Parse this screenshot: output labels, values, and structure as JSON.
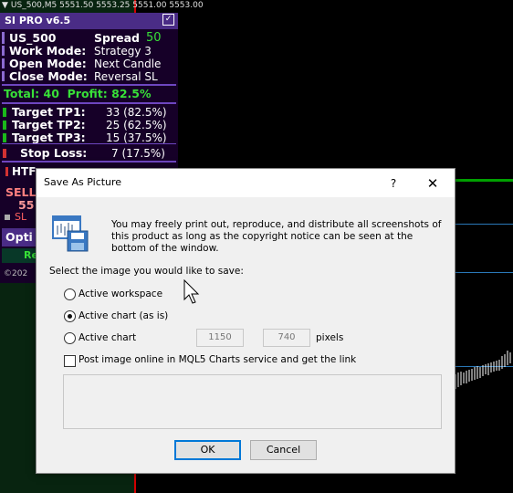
{
  "chart": {
    "title": "US_500,M5  5551.50 5553.25 5551.00 5553.00"
  },
  "panel": {
    "header": "SI PRO v6.5",
    "symbol": "US_500",
    "spread_label": "Spread",
    "spread_value": "50",
    "work_mode_label": "Work Mode:",
    "work_mode_value": "Strategy 3",
    "open_mode_label": "Open Mode:",
    "open_mode_value": "Next Candle",
    "close_mode_label": "Close Mode:",
    "close_mode_value": "Reversal SL",
    "total": "Total: 40",
    "profit": "Profit: 82.5%",
    "tp1_label": "Target TP1:",
    "tp1_value": "33 (82.5%)",
    "tp2_label": "Target TP2:",
    "tp2_value": "25 (62.5%)",
    "tp3_label": "Target TP3:",
    "tp3_value": "15 (37.5%)",
    "sl_label": "Stop Loss:",
    "sl_value": "7 (17.5%)",
    "partial": {
      "htf": "HTF",
      "sell": "SELL",
      "sell_num": "55",
      "sl": "SL",
      "opti": "Opti",
      "re": "Re",
      "copyright": "©202"
    }
  },
  "dialog": {
    "title": "Save As Picture",
    "help": "?",
    "close": "✕",
    "intro": "You may freely print out, reproduce, and distribute all screenshots of this product as long as the copyright notice can be seen at the bottom of the window.",
    "select_label": "Select the image you would like to save:",
    "options": {
      "active_workspace": "Active workspace",
      "active_chart_as_is": "Active chart (as is)",
      "active_chart": "Active chart"
    },
    "width_value": "1150",
    "height_value": "740",
    "x_label": "x",
    "pixels_label": "pixels",
    "post_online_label": "Post image online in MQL5 Charts service and get the link",
    "ok": "OK",
    "cancel": "Cancel"
  },
  "colors": {
    "panel_bg": "#160028",
    "panel_header": "#4a2c86",
    "profit_green": "#38e038",
    "chart_red_line": "#d20000",
    "chart_green_line": "#00a000",
    "chart_blue_line": "#2a78b8"
  }
}
